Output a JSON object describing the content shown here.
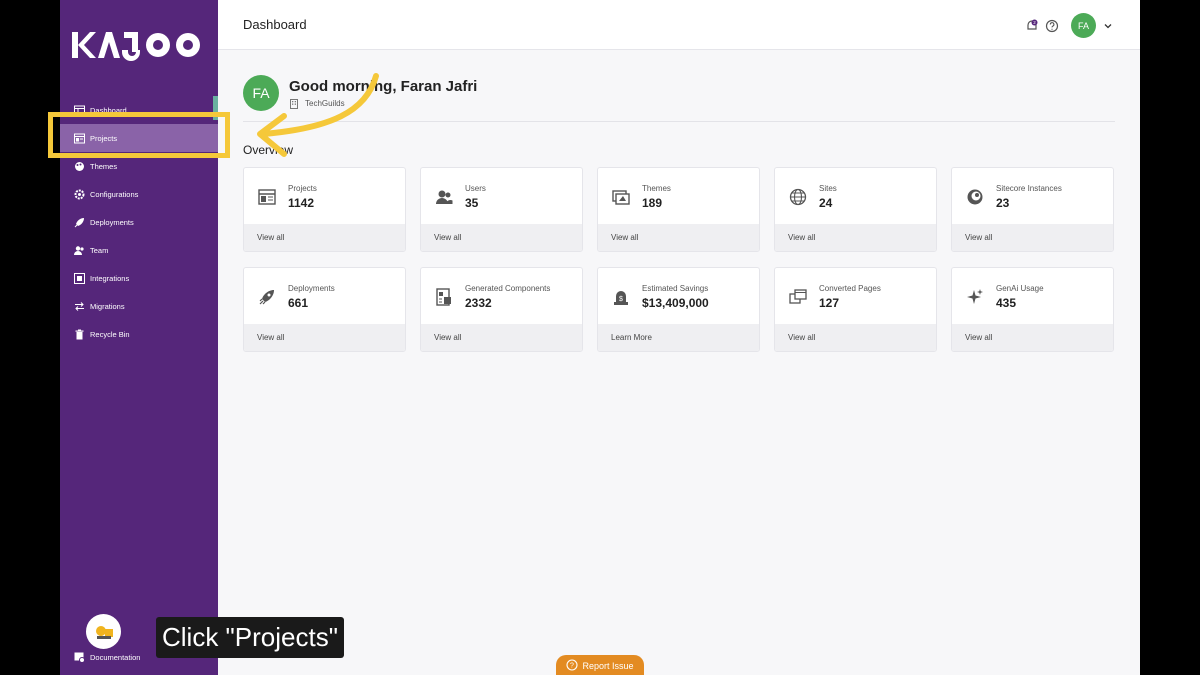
{
  "sidebar": {
    "logo_text": "KAJOO",
    "items": [
      {
        "label": "Dashboard",
        "icon": "dashboard-icon"
      },
      {
        "label": "Projects",
        "icon": "projects-icon"
      },
      {
        "label": "Themes",
        "icon": "themes-icon"
      },
      {
        "label": "Configurations",
        "icon": "gear-icon"
      },
      {
        "label": "Deployments",
        "icon": "rocket-icon"
      },
      {
        "label": "Team",
        "icon": "team-icon"
      },
      {
        "label": "Integrations",
        "icon": "integrations-icon"
      },
      {
        "label": "Migrations",
        "icon": "migrations-icon"
      },
      {
        "label": "Recycle Bin",
        "icon": "trash-icon"
      }
    ],
    "documentation_label": "Documentation"
  },
  "header": {
    "title": "Dashboard",
    "notification_count": "2",
    "user_initials": "FA"
  },
  "greeting": {
    "avatar_initials": "FA",
    "title": "Good morning, Faran Jafri",
    "org": "TechGuilds"
  },
  "overview": {
    "title": "Overview",
    "cards": [
      {
        "label": "Projects",
        "value": "1142",
        "link": "View all",
        "icon": "projects-icon"
      },
      {
        "label": "Users",
        "value": "35",
        "link": "View all",
        "icon": "users-icon"
      },
      {
        "label": "Themes",
        "value": "189",
        "link": "View all",
        "icon": "themes-icon"
      },
      {
        "label": "Sites",
        "value": "24",
        "link": "View all",
        "icon": "globe-icon"
      },
      {
        "label": "Sitecore Instances",
        "value": "23",
        "link": "View all",
        "icon": "sitecore-icon"
      },
      {
        "label": "Deployments",
        "value": "661",
        "link": "View all",
        "icon": "rocket-icon"
      },
      {
        "label": "Generated Components",
        "value": "2332",
        "link": "View all",
        "icon": "components-icon"
      },
      {
        "label": "Estimated Savings",
        "value": "$13,409,000",
        "link": "Learn More",
        "icon": "savings-icon"
      },
      {
        "label": "Converted Pages",
        "value": "127",
        "link": "View all",
        "icon": "pages-icon"
      },
      {
        "label": "GenAi Usage",
        "value": "435",
        "link": "View all",
        "icon": "sparkle-icon"
      }
    ]
  },
  "tutorial": {
    "caption": "Click \"Projects\"",
    "highlight_color": "#f5c83a"
  },
  "report_issue_label": "Report Issue",
  "colors": {
    "sidebar": "#55267a",
    "active_item": "#8a63a8",
    "avatar": "#4caa57",
    "report_button": "#e38b22"
  }
}
